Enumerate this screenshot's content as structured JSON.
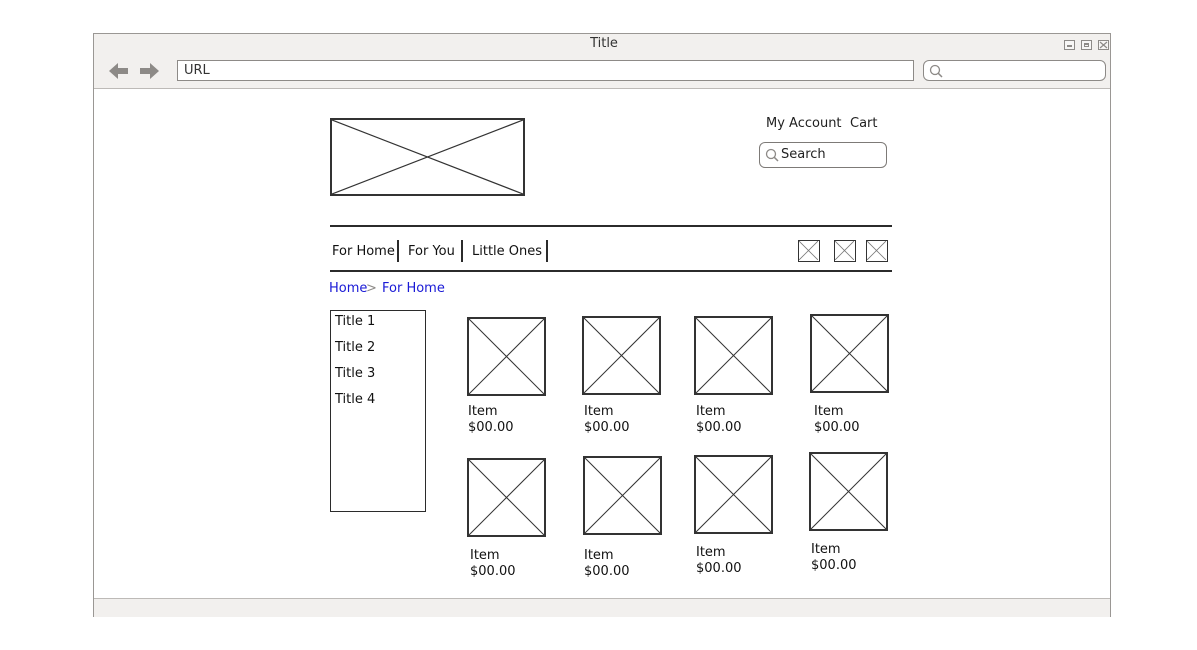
{
  "browser": {
    "title": "Title",
    "url": "URL"
  },
  "header": {
    "my_account": "My Account",
    "cart": "Cart",
    "search_placeholder": "Search"
  },
  "nav": {
    "items": [
      "For Home",
      "For You",
      "Little Ones"
    ]
  },
  "breadcrumb": {
    "home": "Home",
    "separator": ">",
    "current": "For Home"
  },
  "sidebar": {
    "items": [
      "Title 1",
      "Title 2",
      "Title 3",
      "Title 4"
    ]
  },
  "products": [
    {
      "name": "Item",
      "price": "$00.00"
    },
    {
      "name": "Item",
      "price": "$00.00"
    },
    {
      "name": "Item",
      "price": "$00.00"
    },
    {
      "name": "Item",
      "price": "$00.00"
    },
    {
      "name": "Item",
      "price": "$00.00"
    },
    {
      "name": "Item",
      "price": "$00.00"
    },
    {
      "name": "Item",
      "price": "$00.00"
    },
    {
      "name": "Item",
      "price": "$00.00"
    }
  ],
  "colors": {
    "chrome": "#f2f0ee",
    "link_blue": "#1a1ad6",
    "line": "#2b2b2b"
  }
}
